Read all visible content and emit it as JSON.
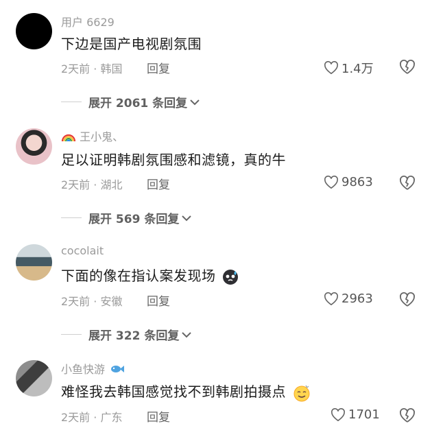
{
  "comments": [
    {
      "username": "用户 6629",
      "text": "下边是国产电视剧氛围",
      "meta": "2天前 · 韩国",
      "reply_label": "回复",
      "likes": "1.4万",
      "expand": "展开 2061 条回复",
      "avatar": "black-avatar"
    },
    {
      "username": "王小鬼、",
      "username_prefix_icon": "rainbow-icon",
      "text": "足以证明韩剧氛围感和滤镜，真的牛",
      "meta": "2天前 · 湖北",
      "reply_label": "回复",
      "likes": "9863",
      "expand": "展开 569 条回复",
      "avatar": "photo-avatar-girl"
    },
    {
      "username": "cocolait",
      "text": "下面的像在指认案发现场",
      "text_suffix_icon": "sweat-emoji-icon",
      "meta": "2天前 · 安徽",
      "reply_label": "回复",
      "likes": "2963",
      "expand": "展开 322 条回复",
      "avatar": "photo-avatar-scene"
    },
    {
      "username": "小鱼快游",
      "username_suffix_icon": "fish-icon",
      "text": "难怪我去韩国感觉找不到韩剧拍摄点",
      "text_suffix_icon": "dizzy-smile-emoji-icon",
      "meta": "2天前 · 广东",
      "reply_label": "回复",
      "likes": "1701",
      "avatar": "photo-avatar-street"
    }
  ]
}
